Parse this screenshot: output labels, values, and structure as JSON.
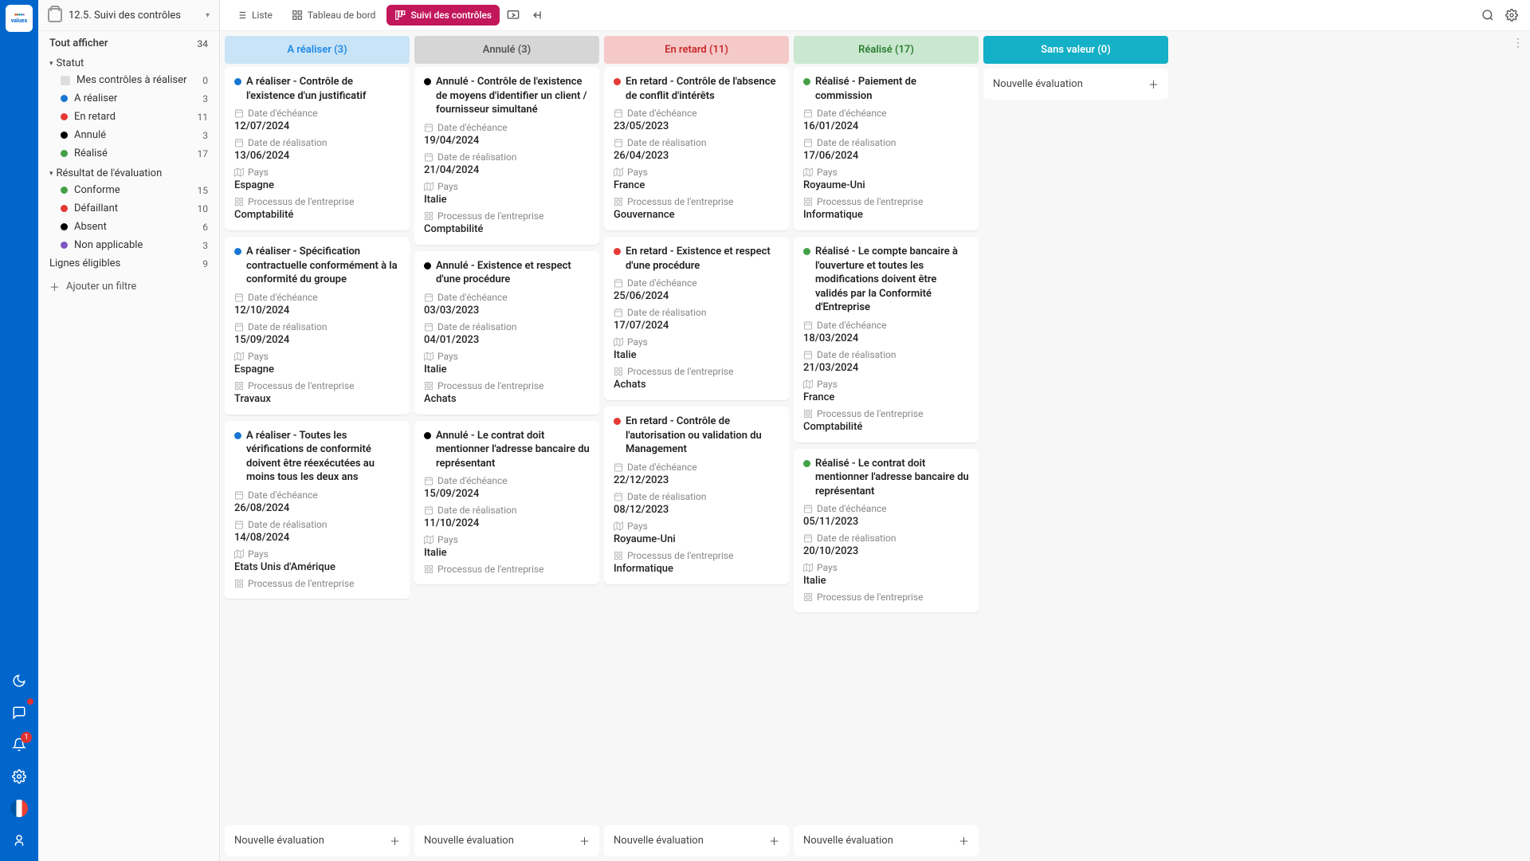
{
  "rail": {
    "notif_count": "1"
  },
  "sidebar": {
    "title": "12.5. Suivi des contrôles",
    "show_all_label": "Tout afficher",
    "show_all_count": "34",
    "groups": [
      {
        "label": "Statut",
        "items": [
          {
            "label": "Mes contrôles à réaliser",
            "count": "0",
            "color": "",
            "person": true
          },
          {
            "label": "A réaliser",
            "count": "3",
            "color": "#1976d2"
          },
          {
            "label": "En retard",
            "count": "11",
            "color": "#e53935"
          },
          {
            "label": "Annulé",
            "count": "3",
            "color": "#000"
          },
          {
            "label": "Réalisé",
            "count": "17",
            "color": "#43a047"
          }
        ]
      },
      {
        "label": "Résultat de l'évaluation",
        "items": [
          {
            "label": "Conforme",
            "count": "15",
            "color": "#43a047"
          },
          {
            "label": "Défaillant",
            "count": "10",
            "color": "#e53935"
          },
          {
            "label": "Absent",
            "count": "6",
            "color": "#000"
          },
          {
            "label": "Non applicable",
            "count": "3",
            "color": "#7e57c2"
          }
        ]
      }
    ],
    "eligibles_label": "Lignes éligibles",
    "eligibles_count": "9",
    "add_filter": "Ajouter un filtre"
  },
  "toolbar": {
    "liste": "Liste",
    "tableau": "Tableau de bord",
    "suivi": "Suivi des contrôles"
  },
  "labels": {
    "echeance": "Date d'échéance",
    "realisation": "Date de réalisation",
    "pays": "Pays",
    "processus": "Processus de l'entreprise",
    "nouvelle": "Nouvelle évaluation"
  },
  "columns": [
    {
      "title": "A réaliser (3)",
      "head_bg": "#c9e4f6",
      "head_fg": "#1e88e5",
      "dot": "#1976d2",
      "cards": [
        {
          "title": "A réaliser - Contrôle de l'existence d'un justificatif",
          "echeance": "12/07/2024",
          "realisation": "13/06/2024",
          "pays": "Espagne",
          "processus": "Comptabilité"
        },
        {
          "title": "A réaliser - Spécification contractuelle conformément à la conformité du groupe",
          "echeance": "12/10/2024",
          "realisation": "15/09/2024",
          "pays": "Espagne",
          "processus": "Travaux"
        },
        {
          "title": "A réaliser - Toutes les vérifications de conformité doivent être réexécutées au moins tous les deux ans",
          "echeance": "26/08/2024",
          "realisation": "14/08/2024",
          "pays": "Etats Unis d'Amérique",
          "processus": ""
        }
      ]
    },
    {
      "title": "Annulé (3)",
      "head_bg": "#d6d6d6",
      "head_fg": "#555",
      "dot": "#000",
      "cards": [
        {
          "title": "Annulé - Contrôle de l'existence de moyens d'identifier un client / fournisseur simultané",
          "echeance": "19/04/2024",
          "realisation": "21/04/2024",
          "pays": "Italie",
          "processus": "Comptabilité"
        },
        {
          "title": "Annulé - Existence et respect d'une procédure",
          "echeance": "03/03/2023",
          "realisation": "04/01/2023",
          "pays": "Italie",
          "processus": "Achats"
        },
        {
          "title": "Annulé - Le contrat doit mentionner l'adresse bancaire du représentant",
          "echeance": "15/09/2024",
          "realisation": "11/10/2024",
          "pays": "Italie",
          "processus": ""
        }
      ]
    },
    {
      "title": "En retard (11)",
      "head_bg": "#f6c9c9",
      "head_fg": "#c62828",
      "dot": "#e53935",
      "cards": [
        {
          "title": "En retard - Contrôle de l'absence de conflit d'intérêts",
          "echeance": "23/05/2023",
          "realisation": "26/04/2023",
          "pays": "France",
          "processus": "Gouvernance"
        },
        {
          "title": "En retard - Existence et respect d'une procédure",
          "echeance": "25/06/2024",
          "realisation": "17/07/2024",
          "pays": "Italie",
          "processus": "Achats"
        },
        {
          "title": "En retard - Contrôle de l'autorisation ou validation du Management",
          "echeance": "22/12/2023",
          "realisation": "08/12/2023",
          "pays": "Royaume-Uni",
          "processus": "Informatique"
        }
      ]
    },
    {
      "title": "Réalisé (17)",
      "head_bg": "#c9e8cf",
      "head_fg": "#2e7d32",
      "dot": "#43a047",
      "cards": [
        {
          "title": "Réalisé - Paiement de commission",
          "echeance": "16/01/2024",
          "realisation": "17/06/2024",
          "pays": "Royaume-Uni",
          "processus": "Informatique"
        },
        {
          "title": "Réalisé - Le compte bancaire à l'ouverture et toutes les modifications doivent être validés par la Conformité d'Entreprise",
          "echeance": "18/03/2024",
          "realisation": "21/03/2024",
          "pays": "France",
          "processus": "Comptabilité"
        },
        {
          "title": "Réalisé - Le contrat doit mentionner l'adresse bancaire du représentant",
          "echeance": "05/11/2023",
          "realisation": "20/10/2023",
          "pays": "Italie",
          "processus": ""
        }
      ]
    },
    {
      "title": "Sans valeur (0)",
      "head_bg": "#13b0c7",
      "head_fg": "#fff",
      "dot": "",
      "cards": []
    }
  ]
}
